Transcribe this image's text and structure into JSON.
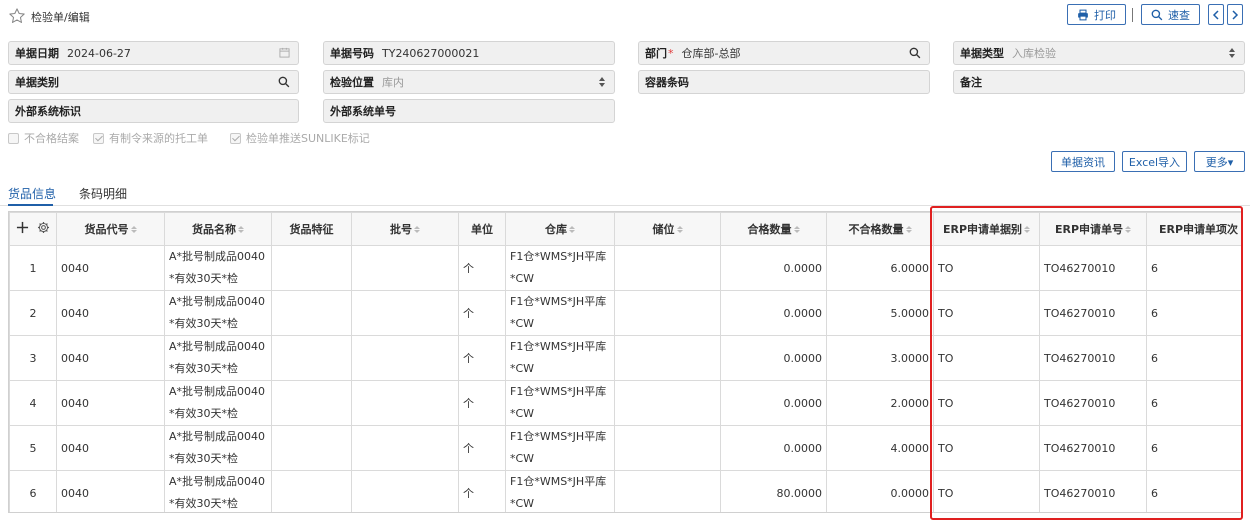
{
  "header": {
    "title": "检验单/编辑",
    "print_label": "打印",
    "search_label": "速查"
  },
  "form": {
    "doc_date": {
      "label": "单据日期",
      "value": "2024-06-27"
    },
    "doc_no": {
      "label": "单据号码",
      "value": "TY240627000021"
    },
    "dept": {
      "label": "部门",
      "required": "*",
      "value": "仓库部-总部"
    },
    "doc_type": {
      "label": "单据类型",
      "value": "入库检验"
    },
    "doc_category": {
      "label": "单据类别",
      "value": ""
    },
    "inspect_loc": {
      "label": "检验位置",
      "value": "库内"
    },
    "container_code": {
      "label": "容器条码",
      "value": ""
    },
    "remark": {
      "label": "备注",
      "value": ""
    },
    "ext_system_id": {
      "label": "外部系统标识",
      "value": ""
    },
    "ext_system_no": {
      "label": "外部系统单号",
      "value": ""
    }
  },
  "checkboxes": [
    {
      "label": "不合格结案",
      "checked": false
    },
    {
      "label": "有制令来源的托工单",
      "checked": true
    },
    {
      "label": "检验单推送SUNLIKE标记",
      "checked": true
    }
  ],
  "actions": {
    "doc_info": "单据资讯",
    "excel_import": "Excel导入",
    "more": "更多▾"
  },
  "tabs": [
    {
      "label": "货品信息",
      "active": true
    },
    {
      "label": "条码明细",
      "active": false
    }
  ],
  "table": {
    "columns": [
      "货品代号",
      "货品名称",
      "货品特征",
      "批号",
      "单位",
      "仓库",
      "储位",
      "合格数量",
      "不合格数量",
      "ERP申请单据别",
      "ERP申请单号",
      "ERP申请单项次"
    ],
    "rows": [
      {
        "idx": "1",
        "code": "0040",
        "name_l1": "A*批号制成品0040",
        "name_l2": "*有效30天*检",
        "feature": "",
        "batch": "",
        "unit": "个",
        "wh_l1": "F1仓*WMS*JH平库",
        "wh_l2": "*CW",
        "loc": "",
        "ok_qty": "0.0000",
        "ng_qty": "6.0000",
        "erp_type": "TO",
        "erp_no": "TO46270010",
        "erp_item": "6"
      },
      {
        "idx": "2",
        "code": "0040",
        "name_l1": "A*批号制成品0040",
        "name_l2": "*有效30天*检",
        "feature": "",
        "batch": "",
        "unit": "个",
        "wh_l1": "F1仓*WMS*JH平库",
        "wh_l2": "*CW",
        "loc": "",
        "ok_qty": "0.0000",
        "ng_qty": "5.0000",
        "erp_type": "TO",
        "erp_no": "TO46270010",
        "erp_item": "6"
      },
      {
        "idx": "3",
        "code": "0040",
        "name_l1": "A*批号制成品0040",
        "name_l2": "*有效30天*检",
        "feature": "",
        "batch": "",
        "unit": "个",
        "wh_l1": "F1仓*WMS*JH平库",
        "wh_l2": "*CW",
        "loc": "",
        "ok_qty": "0.0000",
        "ng_qty": "3.0000",
        "erp_type": "TO",
        "erp_no": "TO46270010",
        "erp_item": "6"
      },
      {
        "idx": "4",
        "code": "0040",
        "name_l1": "A*批号制成品0040",
        "name_l2": "*有效30天*检",
        "feature": "",
        "batch": "",
        "unit": "个",
        "wh_l1": "F1仓*WMS*JH平库",
        "wh_l2": "*CW",
        "loc": "",
        "ok_qty": "0.0000",
        "ng_qty": "2.0000",
        "erp_type": "TO",
        "erp_no": "TO46270010",
        "erp_item": "6"
      },
      {
        "idx": "5",
        "code": "0040",
        "name_l1": "A*批号制成品0040",
        "name_l2": "*有效30天*检",
        "feature": "",
        "batch": "",
        "unit": "个",
        "wh_l1": "F1仓*WMS*JH平库",
        "wh_l2": "*CW",
        "loc": "",
        "ok_qty": "0.0000",
        "ng_qty": "4.0000",
        "erp_type": "TO",
        "erp_no": "TO46270010",
        "erp_item": "6"
      },
      {
        "idx": "6",
        "code": "0040",
        "name_l1": "A*批号制成品0040",
        "name_l2": "*有效30天*检",
        "feature": "",
        "batch": "",
        "unit": "个",
        "wh_l1": "F1仓*WMS*JH平库",
        "wh_l2": "*CW",
        "loc": "",
        "ok_qty": "80.0000",
        "ng_qty": "0.0000",
        "erp_type": "TO",
        "erp_no": "TO46270010",
        "erp_item": "6"
      }
    ]
  },
  "colors": {
    "accent": "#1f5fa8",
    "highlight": "#e02020"
  }
}
